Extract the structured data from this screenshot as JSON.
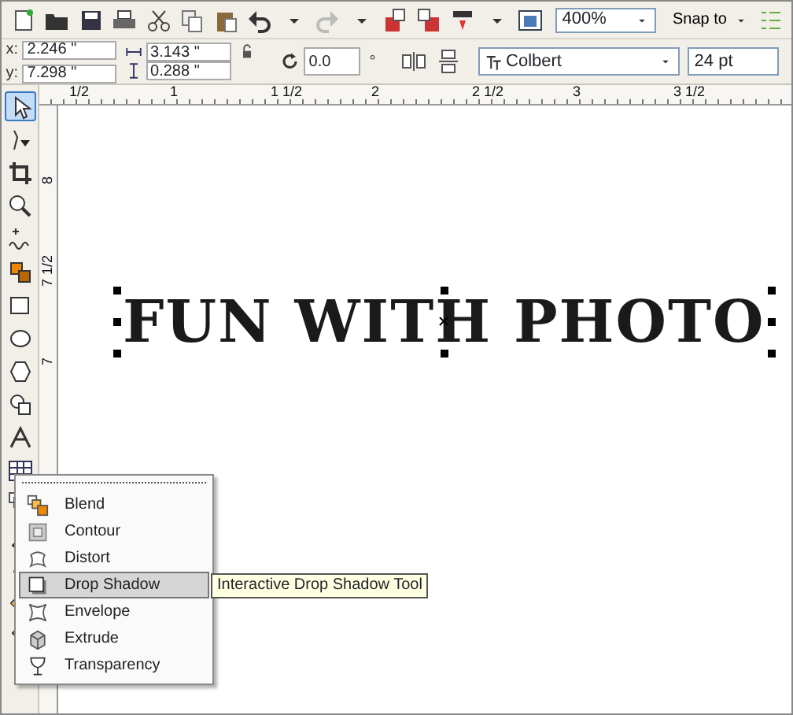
{
  "toolbar": {
    "zoom": "400%",
    "snap_to": "Snap to"
  },
  "property_bar": {
    "x_label": "x:",
    "x": "2.246 \"",
    "y_label": "y:",
    "y": "7.298 \"",
    "width": "3.143 \"",
    "height": "0.288 \"",
    "rotation": "0.0",
    "degree": "°",
    "font": "Colbert",
    "font_size": "24 pt"
  },
  "rulers": {
    "horizontal": [
      "1/2",
      "1",
      "1 1/2",
      "2",
      "2 1/2",
      "3",
      "3 1/2"
    ],
    "vertical": [
      "8",
      "7 1/2",
      "7"
    ]
  },
  "toolbox": [
    {
      "kind": "pick",
      "selected": true
    },
    {
      "kind": "shape",
      "selected": false
    },
    {
      "kind": "crop",
      "selected": false
    },
    {
      "kind": "zoom",
      "selected": false
    },
    {
      "kind": "freehand",
      "selected": false
    },
    {
      "kind": "smartfill",
      "selected": false
    },
    {
      "kind": "rectangle",
      "selected": false
    },
    {
      "kind": "ellipse",
      "selected": false
    },
    {
      "kind": "polygon",
      "selected": false
    },
    {
      "kind": "shapes",
      "selected": false
    },
    {
      "kind": "text",
      "selected": false
    },
    {
      "kind": "table",
      "selected": false
    },
    {
      "kind": "blend",
      "selected": false
    },
    {
      "kind": "eyedropper",
      "selected": false
    },
    {
      "kind": "pen",
      "selected": false
    },
    {
      "kind": "fill",
      "selected": false
    },
    {
      "kind": "interactivefill",
      "selected": false
    }
  ],
  "canvas": {
    "text": "FUN WITH PHOTO"
  },
  "flyout": [
    {
      "label": "Blend",
      "kind": "blend",
      "selected": false
    },
    {
      "label": "Contour",
      "kind": "contour",
      "selected": false
    },
    {
      "label": "Distort",
      "kind": "distort",
      "selected": false
    },
    {
      "label": "Drop Shadow",
      "kind": "shadow",
      "selected": true
    },
    {
      "label": "Envelope",
      "kind": "envelope",
      "selected": false
    },
    {
      "label": "Extrude",
      "kind": "extrude",
      "selected": false
    },
    {
      "label": "Transparency",
      "kind": "transparency",
      "selected": false
    }
  ],
  "tooltip": "Interactive Drop Shadow Tool"
}
